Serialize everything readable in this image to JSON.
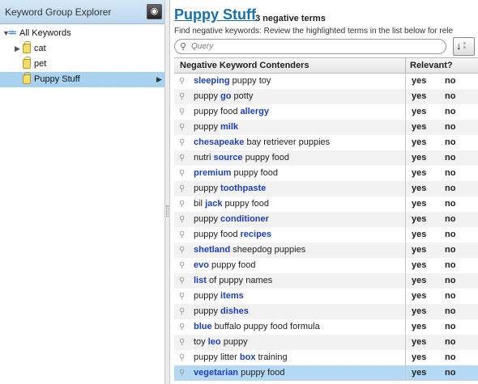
{
  "sidebar": {
    "title": "Keyword Group Explorer",
    "root_label": "All Keywords",
    "items": [
      {
        "label": "cat"
      },
      {
        "label": "pet"
      },
      {
        "label": "Puppy Stuff"
      }
    ]
  },
  "main": {
    "group_title": "Puppy Stuff",
    "negative_count": "3 negative terms",
    "instructions": "Find negative keywords: Review the highlighted terms in the list below for rele",
    "search_placeholder": "Query",
    "columns": {
      "keyword": "Negative Keyword Contenders",
      "relevant": "Relevant?"
    },
    "yes_label": "yes",
    "no_label": "no",
    "rows": [
      {
        "hl": "sleeping",
        "rest": " puppy toy",
        "prefix": ""
      },
      {
        "hl": "go",
        "rest": " potty",
        "prefix": "puppy "
      },
      {
        "hl": "allergy",
        "rest": "",
        "prefix": "puppy food "
      },
      {
        "hl": "milk",
        "rest": "",
        "prefix": "puppy "
      },
      {
        "hl": "chesapeake",
        "rest": " bay retriever puppies",
        "prefix": ""
      },
      {
        "hl": "source",
        "rest": " puppy food",
        "prefix": "nutri "
      },
      {
        "hl": "premium",
        "rest": " puppy food",
        "prefix": ""
      },
      {
        "hl": "toothpaste",
        "rest": "",
        "prefix": "puppy "
      },
      {
        "hl": "jack",
        "rest": " puppy food",
        "prefix": "bil "
      },
      {
        "hl": "conditioner",
        "rest": "",
        "prefix": "puppy "
      },
      {
        "hl": "recipes",
        "rest": "",
        "prefix": "puppy food "
      },
      {
        "hl": "shetland",
        "rest": " sheepdog puppies",
        "prefix": ""
      },
      {
        "hl": "evo",
        "rest": " puppy food",
        "prefix": ""
      },
      {
        "hl": "list",
        "rest": " of puppy names",
        "prefix": ""
      },
      {
        "hl": "items",
        "rest": "",
        "prefix": "puppy "
      },
      {
        "hl": "dishes",
        "rest": "",
        "prefix": "puppy "
      },
      {
        "hl": "blue",
        "rest": " buffalo puppy food formula",
        "prefix": ""
      },
      {
        "hl": "leo",
        "rest": " puppy",
        "prefix": "toy "
      },
      {
        "hl": "box",
        "rest": " training",
        "prefix": "puppy litter "
      },
      {
        "hl": "vegetarian",
        "rest": " puppy food",
        "prefix": ""
      }
    ]
  },
  "colors": {
    "highlight_term": "#1c3fbf",
    "title_link": "#1b6fa8",
    "selection": "#b5d9f3"
  }
}
